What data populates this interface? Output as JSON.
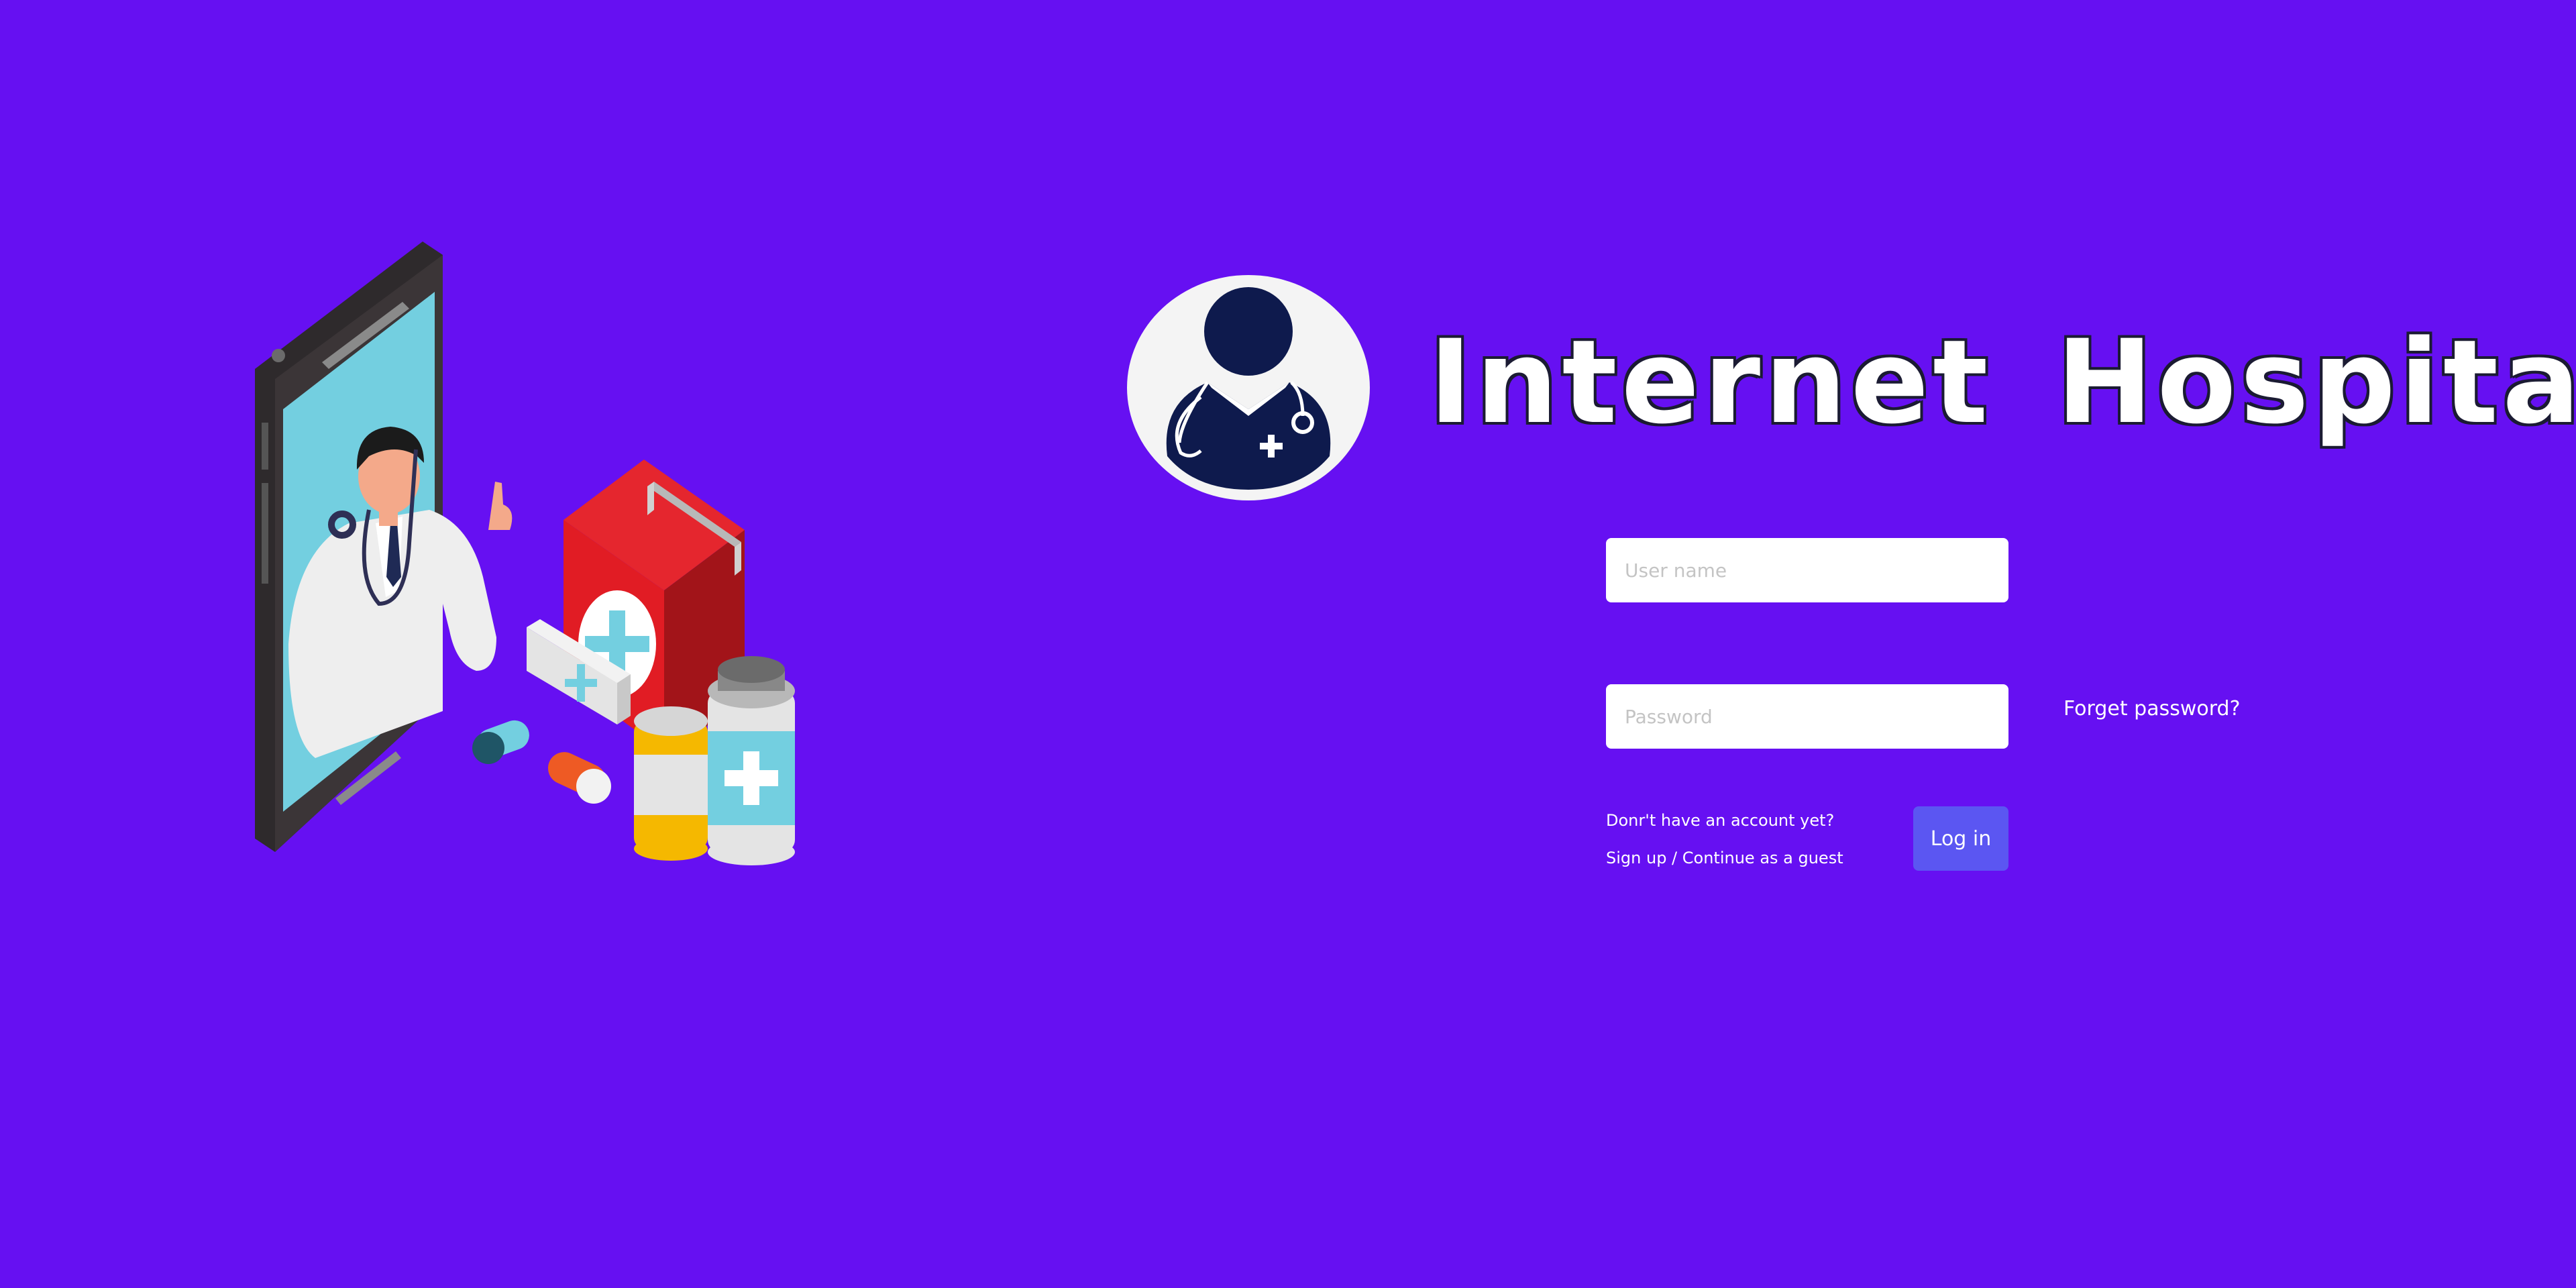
{
  "app": {
    "title": "Internet Hospital"
  },
  "colors": {
    "background": "#6610f2",
    "login_button": "#5b56f2",
    "logo_figure": "#0e1a4d"
  },
  "icons": {
    "logo": "doctor-avatar-icon",
    "illustration": "telemedicine-illustration"
  },
  "login_form": {
    "username_placeholder": "User name",
    "username_value": "",
    "password_placeholder": "Password",
    "password_value": "",
    "forgot_password": "Forget password?",
    "signup_prompt": "Donr't have an account yet?",
    "signup_link": "Sign up / Continue as a guest",
    "login_button": "Log in"
  }
}
